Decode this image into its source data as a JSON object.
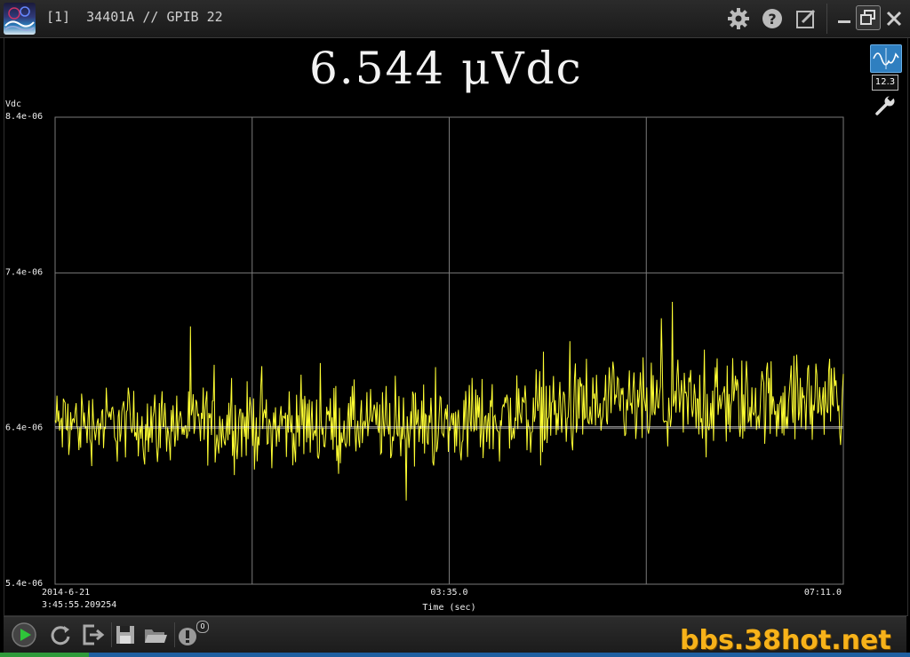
{
  "window": {
    "title": "[1]  34401A // GPIB 22",
    "icons": [
      "app-logo",
      "gear-icon",
      "help-icon",
      "edit-icon",
      "minimize-icon",
      "restore-icon",
      "close-icon"
    ]
  },
  "display": {
    "reading": "6.544 μVdc",
    "numeric_mode_label": "12.3"
  },
  "chart_data": {
    "type": "line",
    "ylabel": "Vdc",
    "xlabel": "Time (sec)",
    "y_ticks": [
      "8.4e-06",
      "7.4e-06",
      "6.4e-06",
      "5.4e-06"
    ],
    "ylim": [
      5.4e-06,
      8.4e-06
    ],
    "x_ticks": [
      {
        "line1": "2014-6-21",
        "line2": "3:45:55.209254"
      },
      {
        "line1": "03:35.0",
        "line2": ""
      },
      {
        "line1": "07:11.0",
        "line2": ""
      }
    ],
    "xlim": [
      0,
      431
    ],
    "grid": true,
    "reference_line": 6.41e-06,
    "series": [
      {
        "color": "#ffff33",
        "x_start": 0,
        "x_step": 0.5,
        "noise_profile": [
          {
            "x": 0,
            "mean": 6.43e-06,
            "amp": 3.5e-07
          },
          {
            "x": 215,
            "mean": 6.42e-06,
            "amp": 3.8e-07
          },
          {
            "x": 260,
            "mean": 6.5e-06,
            "amp": 4.2e-07
          },
          {
            "x": 431,
            "mean": 6.6e-06,
            "amp": 4.2e-07
          }
        ]
      }
    ]
  },
  "toolbar": {
    "tools": [
      "play-icon",
      "refresh-icon",
      "export-icon",
      "save-icon",
      "open-folder-icon",
      "alert-icon"
    ],
    "badge_count": "0"
  },
  "watermark": "bbs.38hot.net"
}
